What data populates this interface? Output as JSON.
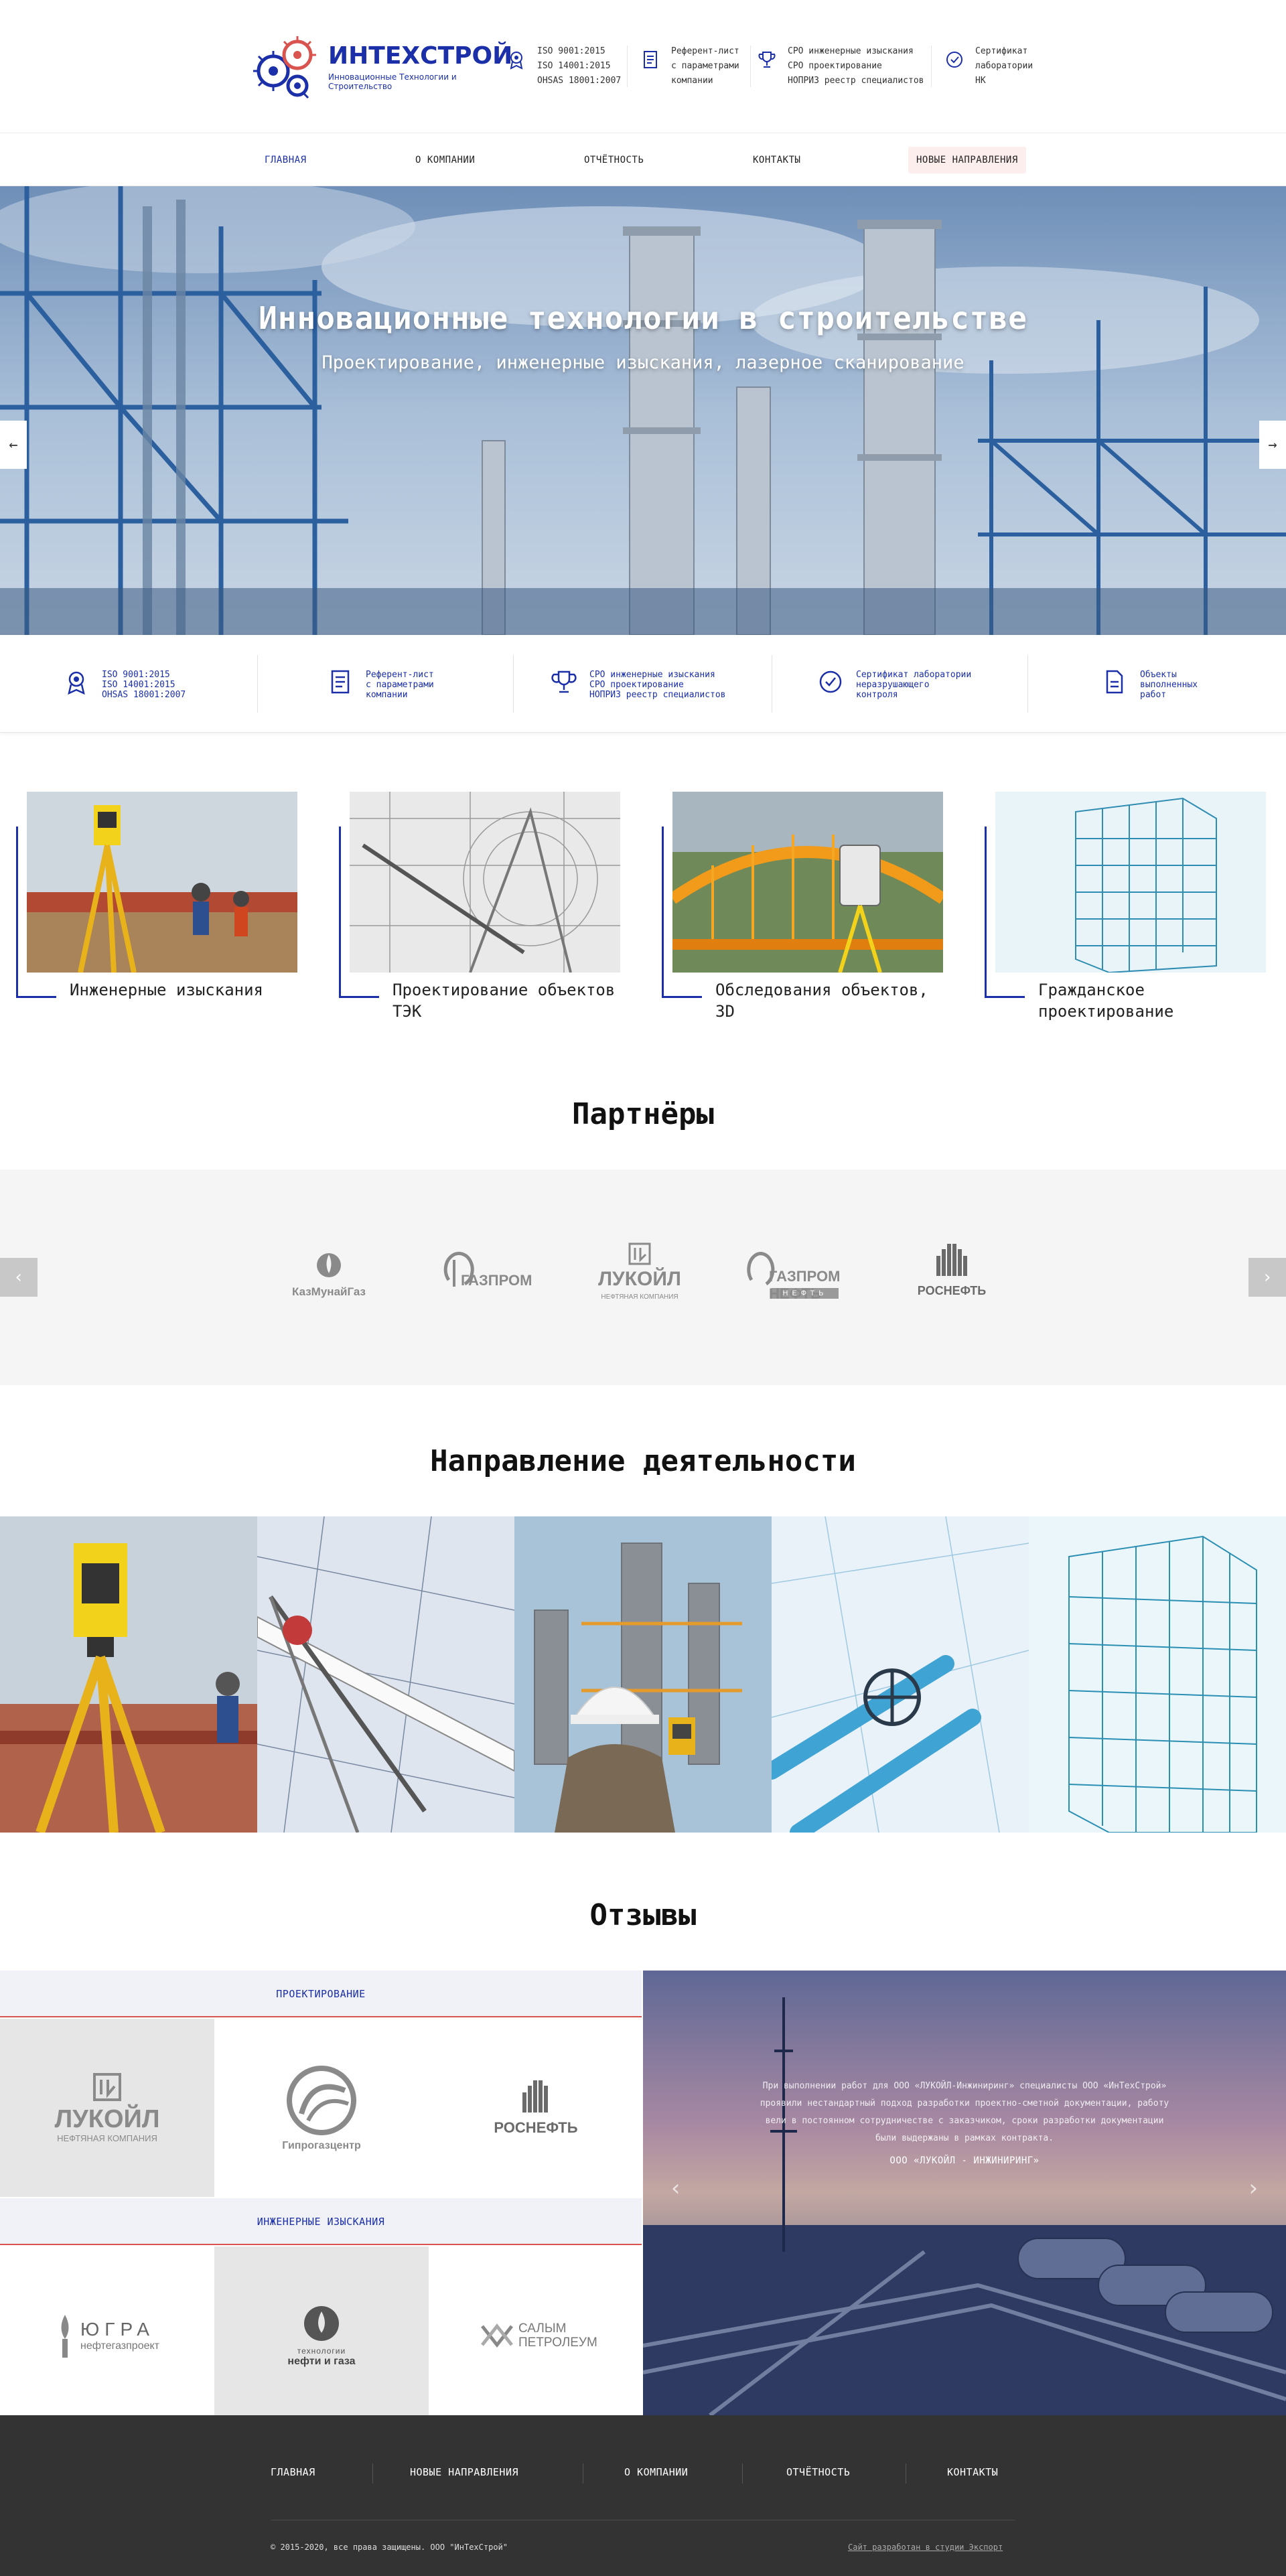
{
  "header": {
    "logo_name": "ИНТЕХСТРОЙ",
    "logo_sub": "Инновационные Технологии и Строительство",
    "certs": [
      {
        "icon": "medal-icon",
        "text": "ISO 9001:2015\nISO 14001:2015\nOHSAS 18001:2007"
      },
      {
        "icon": "document-list-icon",
        "text": "Референт-лист\nс параметрами\nкомпании"
      },
      {
        "icon": "trophy-icon",
        "text": "СРО инженерные изыскания\nСРО проектирование\nНОПРИЗ реестр специалистов"
      },
      {
        "icon": "check-circle-icon",
        "text": "Сертификат\nлаборатории\nНК"
      }
    ]
  },
  "nav": {
    "items": [
      "ГЛАВНАЯ",
      "О КОМПАНИИ",
      "ОТЧЁТНОСТЬ",
      "КОНТАКТЫ",
      "НОВЫЕ НАПРАВЛЕНИЯ"
    ]
  },
  "hero": {
    "title": "Инновационные технологии в строительстве",
    "subtitle": "Проектирование, инженерные изыскания, лазерное сканирование",
    "prev": "←",
    "next": "→"
  },
  "cert_strip": [
    {
      "icon": "medal-icon",
      "text": "ISO 9001:2015\nISO 14001:2015\nOHSAS 18001:2007"
    },
    {
      "icon": "document-list-icon",
      "text": "Референт-лист\nс параметрами\nкомпании"
    },
    {
      "icon": "trophy-icon",
      "text": "СРО инженерные изыскания\nСРО проектирование\nНОПРИЗ реестр специалистов"
    },
    {
      "icon": "check-circle-icon",
      "text": "Сертификат лаборатории\nнеразрушающего\nконтроля"
    },
    {
      "icon": "file-icon",
      "text": "Объекты\nвыполненных\nработ"
    }
  ],
  "services": [
    "Инженерные изыскания",
    "Проектирование объектов ТЭК",
    "Обследования объектов, 3D",
    "Гражданское проектирование"
  ],
  "partners": {
    "title": "Партнёры",
    "logos": [
      "КазМунайГаз",
      "ГАЗПРОМ",
      "ЛУКОЙЛ",
      "ГАЗПРОМ НЕФТЬ",
      "РОСНЕФТЬ"
    ],
    "logo_subs": [
      "",
      "",
      "НЕФТЯНАЯ КОМПАНИЯ",
      "НЕФТЬ",
      ""
    ],
    "prev": "‹",
    "next": "›"
  },
  "directions": {
    "title": "Направление деятельности"
  },
  "reviews": {
    "title": "Отзывы",
    "group1": "ПРОЕКТИРОВАНИЕ",
    "group2": "ИНЖЕНЕРНЫЕ ИЗЫСКАНИЯ",
    "logos1": [
      "ЛУКОЙЛ",
      "Гипрогазцентр",
      "РОСНЕФТЬ"
    ],
    "logos1_subs": [
      "НЕФТЯНАЯ КОМПАНИЯ",
      "",
      ""
    ],
    "logos2": [
      "ЮГРА",
      "нефти и газа",
      "САЛЫМ ПЕТРОЛЕУМ"
    ],
    "logos2_subs": [
      "нефтегазпроект",
      "технологии",
      ""
    ],
    "quote": "При выполнении работ для ООО «ЛУКОЙЛ-Инжиниринг» специалисты ООО «ИнТехСтрой»\nпроявили нестандартный подход разработки проектно-сметной документации, работу\nвели в постоянном сотрудничестве с заказчиком, сроки разработки документации\nбыли выдержаны в рамках контракта.",
    "author": "ООО «ЛУКОЙЛ - ИНЖИНИРИНГ»",
    "prev": "‹",
    "next": "›"
  },
  "footer": {
    "items": [
      "ГЛАВНАЯ",
      "НОВЫЕ НАПРАВЛЕНИЯ",
      "О КОМПАНИИ",
      "ОТЧЁТНОСТЬ",
      "КОНТАКТЫ"
    ],
    "copyright": "© 2015-2020, все права защищены. ООО \"ИнТехСтрой\"",
    "studio": "Сайт разработан в студии Экспорт"
  },
  "colors": {
    "brand_blue": "#1b2fa8",
    "accent_red": "#d9534f",
    "footer_bg": "#333333"
  }
}
